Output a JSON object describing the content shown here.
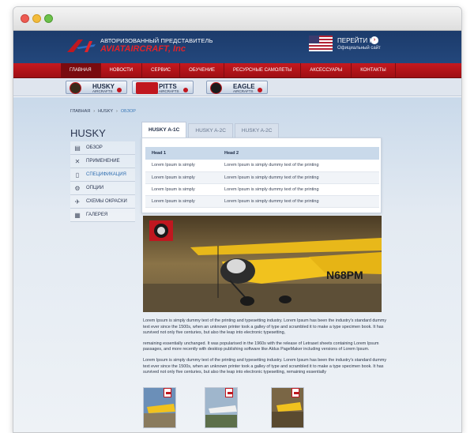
{
  "header": {
    "tagline": "АВТОРИЗОВАННЫЙ ПРЕДСТАВИТЕЛЬ",
    "brand": "AVIATAIRCRAFT, Inc",
    "goto_label": "ПЕРЕЙТИ НА",
    "goto_arrow": "›",
    "goto_sub": "Официальный сайт"
  },
  "mainnav": [
    "ГЛАВНАЯ",
    "НОВОСТИ",
    "СЕРВИС",
    "ОБУЧЕНИЕ",
    "РЕСУРСНЫЕ САМОЛЕТЫ",
    "АКСЕССУАРЫ",
    "КОНТАКТЫ"
  ],
  "models": [
    {
      "name": "HUSKY",
      "sub": "AIRCRAFTS"
    },
    {
      "name": "PITTS",
      "sub": "AIRCRAFTS"
    },
    {
      "name": "EAGLE",
      "sub": "AIRCRAFTS"
    }
  ],
  "breadcrumb": {
    "home": "ГЛАВНАЯ",
    "section": "HUSKY",
    "current": "ОБЗОР",
    "sep": "›"
  },
  "sidebar": {
    "title": "HUSKY",
    "items": [
      {
        "label": "ОБЗОР",
        "icon": "book-icon"
      },
      {
        "label": "ПРИМЕНЕНИЕ",
        "icon": "tools-icon"
      },
      {
        "label": "СПЕЦИФИКАЦИЯ",
        "icon": "document-icon"
      },
      {
        "label": "ОПЦИИ",
        "icon": "gear-icon"
      },
      {
        "label": "СХЕМЫ ОКРАСКИ",
        "icon": "palette-icon"
      },
      {
        "label": "ГАЛЕРЕЯ",
        "icon": "gallery-icon"
      }
    ]
  },
  "tabs": [
    "HUSKY A-1C",
    "HUSKY A-2C",
    "HUSKY A-2C"
  ],
  "table": {
    "headers": [
      "Head 1",
      "Head 2"
    ],
    "rows": [
      [
        "Lorem Ipsum is simply",
        "Lorem Ipsum is simply dummy text of the printing"
      ],
      [
        "Lorem Ipsum is simply",
        "Lorem Ipsum is simply dummy text of the printing"
      ],
      [
        "Lorem Ipsum is simply",
        "Lorem Ipsum is simply dummy text of the printing"
      ],
      [
        "Lorem Ipsum is simply",
        "Lorem Ipsum is simply dummy text of the printing"
      ]
    ]
  },
  "photo": {
    "tail_number": "N68PM"
  },
  "body": {
    "p1": "Lorem Ipsum is simply dummy text of the printing and typesetting industry. Lorem Ipsum has been the industry's standard dummy text ever since the 1500s, when an unknown printer took a galley of type and scrambled it to make a type specimen book. It has survived not only five centuries, but also the leap into electronic typesetting,",
    "p2": "remaining essentially unchanged. It was popularised in the 1960s with the release of Letraset sheets containing Lorem Ipsum passages, and more recently with desktop publishing software like Aldus PageMaker including versions of Lorem Ipsum.",
    "p3": "Lorem Ipsum is simply dummy text of the printing and typesetting industry. Lorem Ipsum has been the industry's standard dummy text ever since the 1500s, when an unknown printer took a galley of type and scrambled it to make a type specimen book. It has survived not only five centuries, but also the leap into electronic typesetting, remaining essentially"
  },
  "colors": {
    "accent_red": "#c0171f",
    "header_blue": "#1c3b6b",
    "link_blue": "#2f6fb0"
  }
}
